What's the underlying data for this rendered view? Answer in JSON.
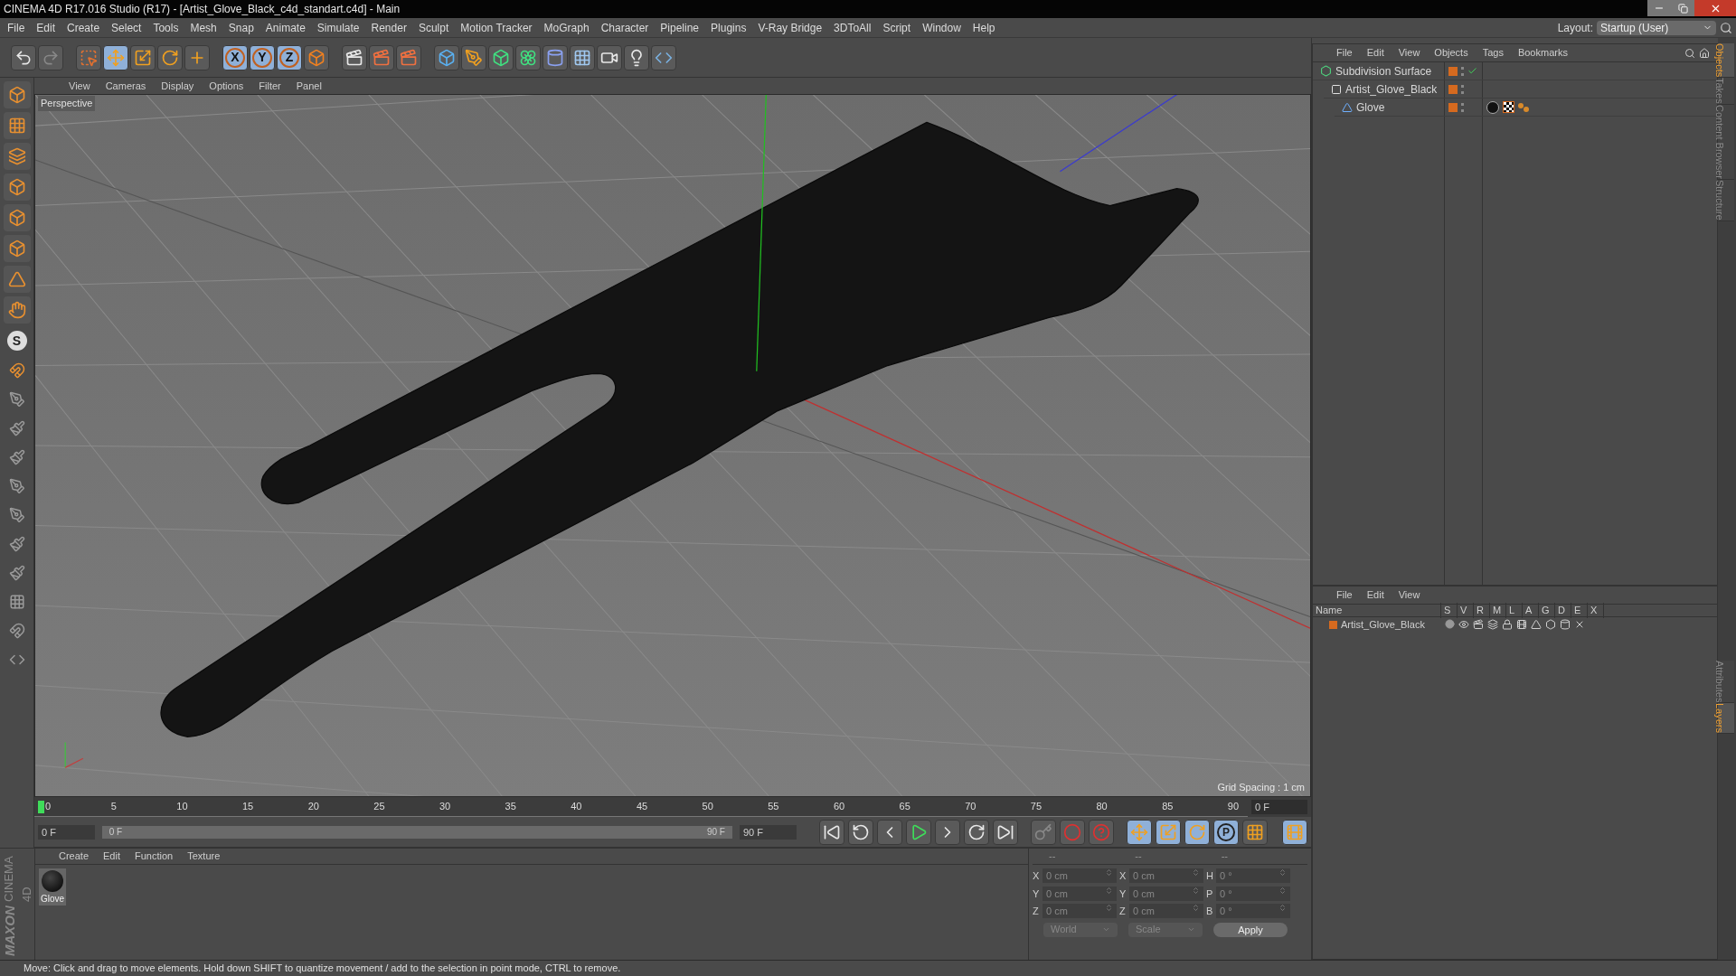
{
  "window": {
    "title": "CINEMA 4D R17.016 Studio (R17) - [Artist_Glove_Black_c4d_standart.c4d] - Main"
  },
  "menu": [
    "File",
    "Edit",
    "Create",
    "Select",
    "Tools",
    "Mesh",
    "Snap",
    "Animate",
    "Simulate",
    "Render",
    "Sculpt",
    "Motion Tracker",
    "MoGraph",
    "Character",
    "Pipeline",
    "Plugins",
    "V-Ray Bridge",
    "3DToAll",
    "Script",
    "Window",
    "Help"
  ],
  "layout": {
    "label": "Layout:",
    "value": "Startup (User)"
  },
  "toolbar": {
    "axis_buttons": [
      "X",
      "Y",
      "Z"
    ]
  },
  "left_tools": {
    "snap_label": "S"
  },
  "viewport": {
    "menu": [
      "View",
      "Cameras",
      "Display",
      "Options",
      "Filter",
      "Panel"
    ],
    "camera": "Perspective",
    "grid_spacing": "Grid Spacing : 1 cm"
  },
  "timeline": {
    "ticks": [
      "0",
      "5",
      "10",
      "15",
      "20",
      "25",
      "30",
      "35",
      "40",
      "45",
      "50",
      "55",
      "60",
      "65",
      "70",
      "75",
      "80",
      "85",
      "90"
    ],
    "current_frame": "0 F",
    "start": "0 F",
    "range": {
      "start": "0 F",
      "end": "90 F",
      "level": 1
    },
    "end": "90 F",
    "key_button": "P"
  },
  "materials": {
    "menu": [
      "Create",
      "Edit",
      "Function",
      "Texture"
    ],
    "items": [
      {
        "name": "Glove"
      }
    ]
  },
  "logo": {
    "brand": "MAXON",
    "product": "CINEMA 4D"
  },
  "coordinates": {
    "headers": [
      "--",
      "--",
      "--"
    ],
    "columns": [
      [
        {
          "axis": "X",
          "value": "0 cm"
        },
        {
          "axis": "Y",
          "value": "0 cm"
        },
        {
          "axis": "Z",
          "value": "0 cm"
        }
      ],
      [
        {
          "axis": "X",
          "value": "0 cm"
        },
        {
          "axis": "Y",
          "value": "0 cm"
        },
        {
          "axis": "Z",
          "value": "0 cm"
        }
      ],
      [
        {
          "axis": "H",
          "value": "0 °"
        },
        {
          "axis": "P",
          "value": "0 °"
        },
        {
          "axis": "B",
          "value": "0 °"
        }
      ]
    ],
    "mode": "World",
    "transform": "Scale",
    "apply": "Apply"
  },
  "objects": {
    "menu": [
      "File",
      "Edit",
      "View",
      "Objects",
      "Tags",
      "Bookmarks"
    ],
    "tree": [
      {
        "name": "Subdivision Surface",
        "kind": "subdivision",
        "checked": true,
        "children": [
          {
            "name": "Artist_Glove_Black",
            "kind": "null",
            "checked": false,
            "children": [
              {
                "name": "Glove",
                "kind": "mesh",
                "checked": false
              }
            ]
          }
        ]
      }
    ]
  },
  "layers": {
    "menu": [
      "File",
      "Edit",
      "View"
    ],
    "columns": [
      "Name",
      "S",
      "V",
      "R",
      "M",
      "L",
      "A",
      "G",
      "D",
      "E",
      "X"
    ],
    "rows": [
      {
        "name": "Artist_Glove_Black"
      }
    ]
  },
  "side_tabs_top": [
    {
      "label": "Objects",
      "selected": true
    },
    {
      "label": "Takes",
      "selected": false
    },
    {
      "label": "Content Browser",
      "selected": false
    },
    {
      "label": "Structure",
      "selected": false
    }
  ],
  "side_tabs_bottom": [
    {
      "label": "Attributes",
      "selected": false
    },
    {
      "label": "Layers",
      "selected": true
    }
  ],
  "status_bar": "Move: Click and drag to move elements. Hold down SHIFT to quantize movement / add to the selection in point mode, CTRL to remove."
}
